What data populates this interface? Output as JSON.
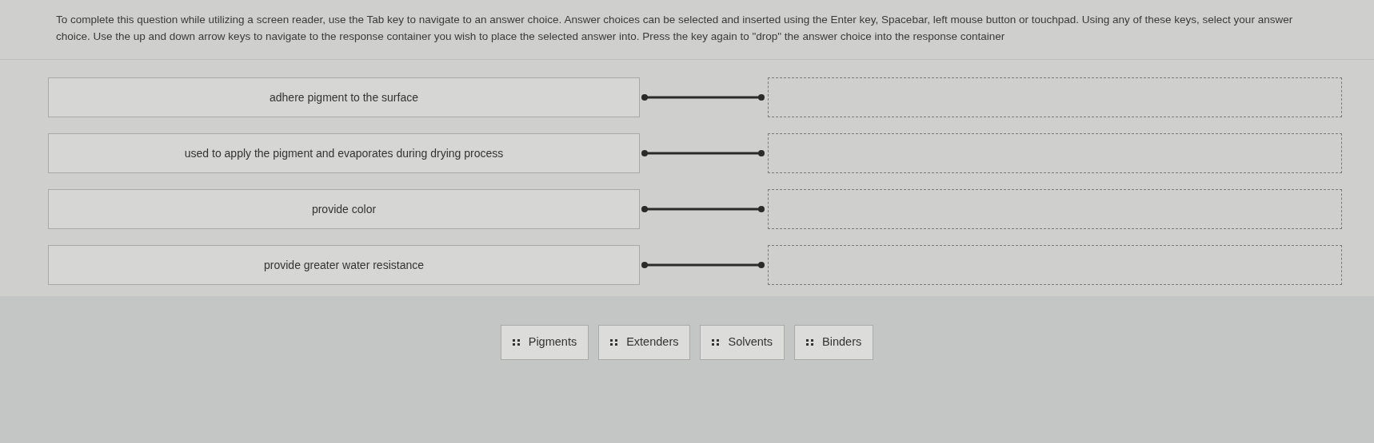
{
  "instructions": "To complete this question while utilizing a screen reader, use the Tab key to navigate to an answer choice. Answer choices can be selected and inserted using the Enter key, Spacebar, left mouse button or touchpad. Using any of these keys, select your answer choice. Use the up and down arrow keys to navigate to the response container you wish to place the selected answer into. Press the key again to \"drop\" the answer choice into the response container",
  "matches": [
    {
      "prompt": "adhere pigment to the surface"
    },
    {
      "prompt": "used to apply the pigment and evaporates during drying process"
    },
    {
      "prompt": "provide color"
    },
    {
      "prompt": "provide greater water resistance"
    }
  ],
  "answer_choices": [
    "Pigments",
    "Extenders",
    "Solvents",
    "Binders"
  ]
}
